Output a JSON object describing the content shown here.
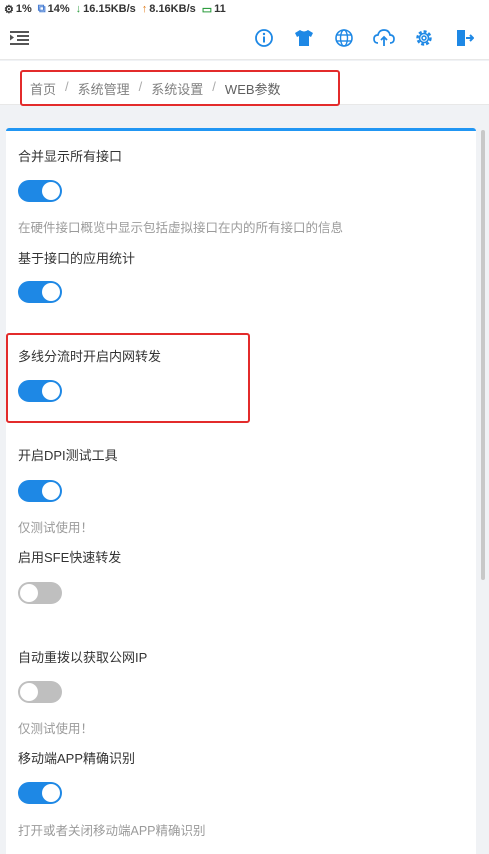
{
  "status": {
    "cpu": "1%",
    "mem": "14%",
    "down": "16.15KB/s",
    "up": "8.16KB/s",
    "devices": "11"
  },
  "topbar": {
    "icons": [
      "info-icon",
      "shirt-icon",
      "globe-icon",
      "cloud-upload-icon",
      "gear-icon",
      "logout-icon"
    ],
    "accent": "#1e88e5"
  },
  "breadcrumb": {
    "items": [
      "首页",
      "系统管理",
      "系统设置",
      "WEB参数"
    ],
    "separator": "/"
  },
  "settings": [
    {
      "label": "合并显示所有接口",
      "enabled": true,
      "hint": "在硬件接口概览中显示包括虚拟接口在内的所有接口的信息"
    },
    {
      "label": "基于接口的应用统计",
      "enabled": true,
      "hint": ""
    },
    {
      "label": "多线分流时开启内网转发",
      "enabled": true,
      "hint": ""
    },
    {
      "label": "开启DPI测试工具",
      "enabled": true,
      "hint": "仅测试使用！"
    },
    {
      "label": "启用SFE快速转发",
      "enabled": false,
      "hint": ""
    },
    {
      "label": "自动重拨以获取公网IP",
      "enabled": false,
      "hint": "仅测试使用！"
    },
    {
      "label": "移动端APP精确识别",
      "enabled": true,
      "hint": "打开或者关闭移动端APP精确识别"
    }
  ],
  "colors": {
    "toggle_on": "#1e88e5",
    "toggle_off": "#bfbfbf",
    "highlight": "#e32b2b"
  }
}
